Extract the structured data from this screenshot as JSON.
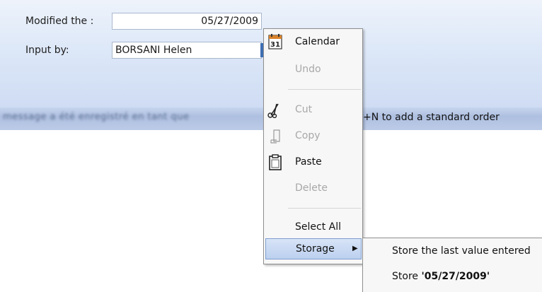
{
  "form": {
    "modified_label": "Modified the :",
    "modified_value": "05/27/2009",
    "input_by_label": "Input by:",
    "input_by_value": "BORSANI Helen"
  },
  "message_bar": {
    "blurred_text": "message a été enregistré en tant que",
    "text": "+N to add a standard order"
  },
  "context_menu": {
    "items": [
      {
        "label": "Calendar",
        "icon": "calendar-icon",
        "icon_text": "31",
        "enabled": true
      },
      {
        "label": "Undo",
        "enabled": false
      },
      {
        "label": "Cut",
        "icon": "scissors-icon",
        "enabled": false
      },
      {
        "label": "Copy",
        "icon": "copy-icon",
        "enabled": false
      },
      {
        "label": "Paste",
        "icon": "clipboard-icon",
        "enabled": true
      },
      {
        "label": "Delete",
        "enabled": false
      },
      {
        "label": "Select All",
        "enabled": true
      },
      {
        "label": "Storage",
        "enabled": true,
        "has_submenu": true,
        "highlighted": true
      }
    ]
  },
  "submenu": {
    "store_last": "Store the last value entered",
    "store_prefix": "Store ",
    "store_value": "'05/27/2009'"
  },
  "colors": {
    "panel_gradient_top": "#eef3fb",
    "panel_gradient_bottom": "#cfdcf3",
    "message_bar": "#aebfe0",
    "menu_background": "#f7f7f7",
    "highlight": "#bcd0ef",
    "disabled_text": "#a8a8a8"
  }
}
